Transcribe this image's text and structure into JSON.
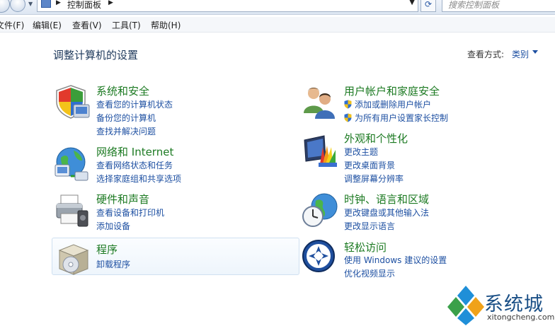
{
  "address_bar": {
    "path": "控制面板",
    "search_placeholder": "搜索控制面板"
  },
  "menu": [
    {
      "label": "文件(F)"
    },
    {
      "label": "编辑(E)"
    },
    {
      "label": "查看(V)"
    },
    {
      "label": "工具(T)"
    },
    {
      "label": "帮助(H)"
    }
  ],
  "header": {
    "title": "调整计算机的设置",
    "view_by_label": "查看方式:",
    "view_by_value": "类别"
  },
  "categories": {
    "system_security": {
      "title": "系统和安全",
      "links": [
        "查看您的计算机状态",
        "备份您的计算机",
        "查找并解决问题"
      ]
    },
    "network": {
      "title": "网络和 Internet",
      "links": [
        "查看网络状态和任务",
        "选择家庭组和共享选项"
      ]
    },
    "hardware": {
      "title": "硬件和声音",
      "links": [
        "查看设备和打印机",
        "添加设备"
      ]
    },
    "programs": {
      "title": "程序",
      "links": [
        "卸载程序"
      ]
    },
    "user_accounts": {
      "title": "用户帐户和家庭安全",
      "links": [
        "添加或删除用户帐户",
        "为所有用户设置家长控制"
      ]
    },
    "appearance": {
      "title": "外观和个性化",
      "links": [
        "更改主题",
        "更改桌面背景",
        "调整屏幕分辨率"
      ]
    },
    "clock": {
      "title": "时钟、语言和区域",
      "links": [
        "更改键盘或其他输入法",
        "更改显示语言"
      ]
    },
    "ease": {
      "title": "轻松访问",
      "links": [
        "使用 Windows 建议的设置",
        "优化视频显示"
      ]
    }
  },
  "watermark": {
    "text": "系统城",
    "url": "xitongcheng.com"
  },
  "colors": {
    "category_title": "#1c7a22",
    "link": "#1e50a2",
    "page_title": "#1e395b"
  }
}
